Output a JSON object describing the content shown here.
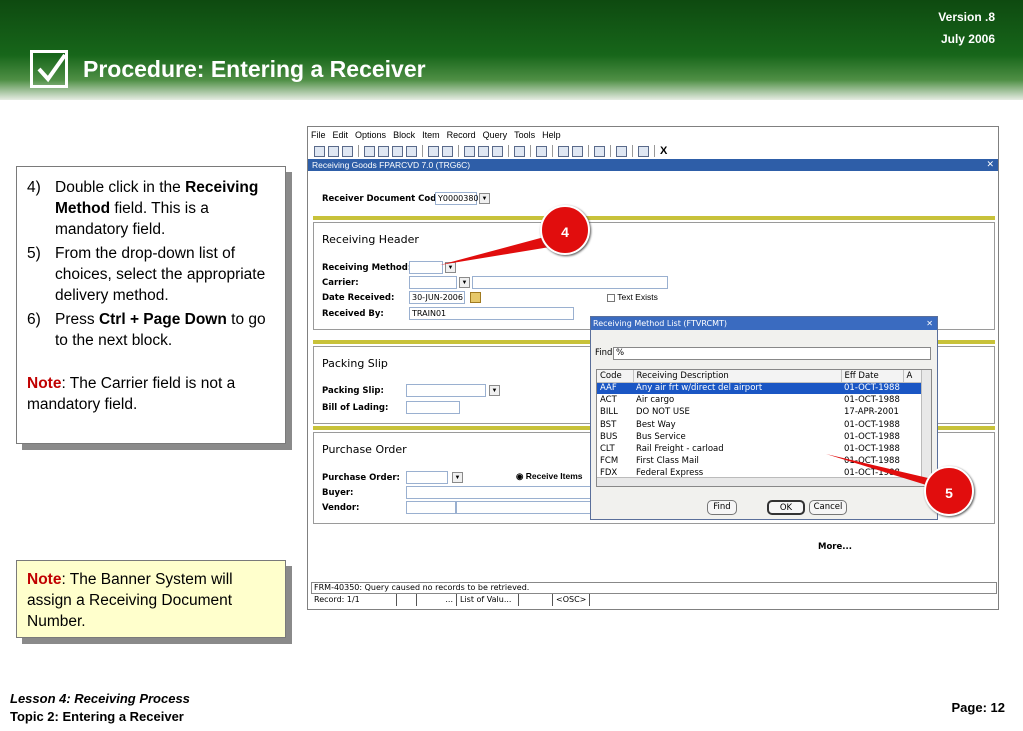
{
  "header": {
    "version": "Version .8",
    "date": "July  2006",
    "title": "Procedure: Entering a Receiver"
  },
  "instructions": {
    "steps": [
      {
        "num": "4)",
        "pre": "Double click in the ",
        "bold": "Receiving Method",
        "post": " field. This is a mandatory field."
      },
      {
        "num": "5)",
        "pre": "From the drop-down list of choices, select the appropriate delivery method.",
        "bold": "",
        "post": ""
      },
      {
        "num": "6)",
        "pre": "Press ",
        "bold": "Ctrl + Page Down",
        "post": " to go to the next block."
      }
    ],
    "note_label": "Note",
    "note_text": ": The Carrier field is not a mandatory field."
  },
  "note2": {
    "label": "Note",
    "text": ": The Banner System will assign a Receiving Document Number."
  },
  "footer": {
    "lesson": "Lesson 4: Receiving Process",
    "topic": "Topic 2: Entering a Receiver",
    "page": "Page: 12"
  },
  "app": {
    "menu": [
      "File",
      "Edit",
      "Options",
      "Block",
      "Item",
      "Record",
      "Query",
      "Tools",
      "Help"
    ],
    "form_title": "Receiving Goods  FPARCVD  7.0  (TRG6C)",
    "receiver_doc_label": "Receiver Document Code",
    "receiver_doc_value": "Y0000380",
    "header_section": "Receiving Header",
    "receiving_method_label": "Receiving Method:",
    "carrier_label": "Carrier:",
    "date_received_label": "Date Received:",
    "date_received_value": "30-JUN-2006",
    "text_exists_label": "Text Exists",
    "received_by_label": "Received By:",
    "received_by_value": "TRAIN01",
    "packing_section": "Packing Slip",
    "packing_slip_label": "Packing Slip:",
    "bill_of_lading_label": "Bill of Lading:",
    "po_section": "Purchase Order",
    "po_label": "Purchase Order:",
    "receive_items_label": "Receive Items",
    "buyer_label": "Buyer:",
    "vendor_label": "Vendor:",
    "more_label": "More...",
    "status_message": "FRM-40350: Query caused no records to be retrieved.",
    "status_record": "Record: 1/1",
    "status_ellipsis": "...",
    "status_list": "List of Valu...",
    "status_osc": "<OSC>"
  },
  "popup": {
    "title": "Receiving Method List (FTVRCMT)",
    "find_label": "Find",
    "find_value": "%",
    "columns": [
      "Code",
      "Receiving Description",
      "Eff Date",
      "A"
    ],
    "rows": [
      [
        "AAF",
        "Any air frt w/direct del airport",
        "01-OCT-1988"
      ],
      [
        "ACT",
        "Air cargo",
        "01-OCT-1988"
      ],
      [
        "BILL",
        "DO NOT USE",
        "17-APR-2001"
      ],
      [
        "BST",
        "Best Way",
        "01-OCT-1988"
      ],
      [
        "BUS",
        "Bus Service",
        "01-OCT-1988"
      ],
      [
        "CLT",
        "Rail Freight - carload",
        "01-OCT-1988"
      ],
      [
        "FCM",
        "First Class Mail",
        "01-OCT-1988"
      ],
      [
        "FDX",
        "Federal Express",
        "01-OCT-1988"
      ]
    ],
    "find_button": "Find",
    "ok_button": "OK",
    "cancel_button": "Cancel"
  },
  "callouts": {
    "first": "4",
    "second": "5"
  },
  "colors": {
    "banner": "#17661a",
    "callout": "#e10d0d",
    "note": "#c00000",
    "selection": "#1a56c4"
  }
}
